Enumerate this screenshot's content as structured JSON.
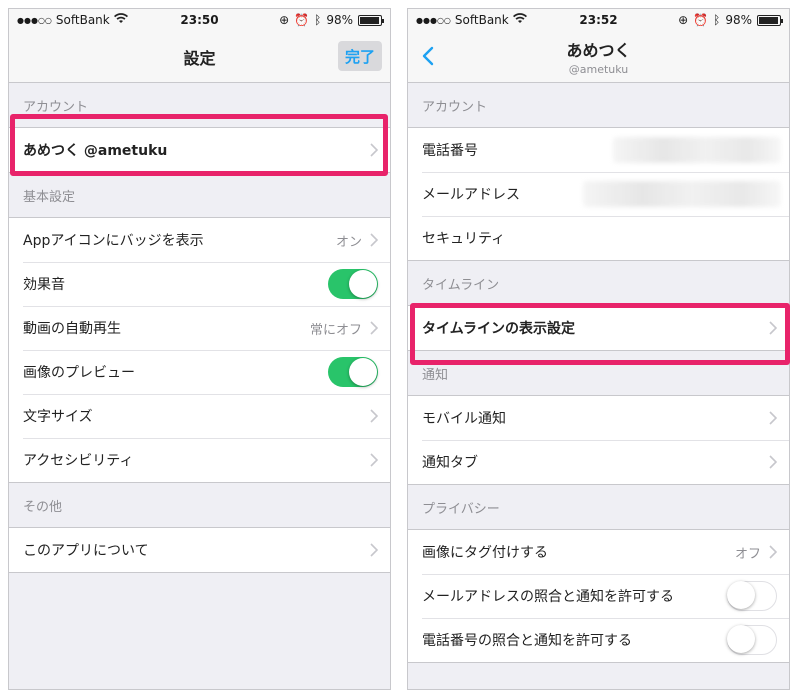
{
  "left": {
    "status": {
      "carrier": "SoftBank",
      "time": "23:50",
      "battery": "98%"
    },
    "nav": {
      "title": "設定",
      "done_label": "完了"
    },
    "sections": [
      {
        "header": "アカウント",
        "rows": [
          {
            "label": "あめつく @ametuku"
          }
        ]
      },
      {
        "header": "基本設定",
        "rows": [
          {
            "label": "Appアイコンにバッジを表示",
            "value": "オン"
          },
          {
            "label": "効果音",
            "toggle": "on"
          },
          {
            "label": "動画の自動再生",
            "value": "常にオフ"
          },
          {
            "label": "画像のプレビュー",
            "toggle": "on"
          },
          {
            "label": "文字サイズ"
          },
          {
            "label": "アクセシビリティ"
          }
        ]
      },
      {
        "header": "その他",
        "rows": [
          {
            "label": "このアプリについて"
          }
        ]
      }
    ]
  },
  "right": {
    "status": {
      "carrier": "SoftBank",
      "time": "23:52",
      "battery": "98%"
    },
    "nav": {
      "title": "あめつく",
      "subtitle": "@ametuku"
    },
    "sections": [
      {
        "header": "アカウント",
        "rows": [
          {
            "label": "電話番号"
          },
          {
            "label": "メールアドレス"
          },
          {
            "label": "セキュリティ"
          }
        ]
      },
      {
        "header": "タイムライン",
        "rows": [
          {
            "label": "タイムラインの表示設定"
          }
        ]
      },
      {
        "header": "通知",
        "rows": [
          {
            "label": "モバイル通知"
          },
          {
            "label": "通知タブ"
          }
        ]
      },
      {
        "header": "プライバシー",
        "rows": [
          {
            "label": "画像にタグ付けする",
            "value": "オフ"
          },
          {
            "label": "メールアドレスの照合と通知を許可する",
            "toggle": "off"
          },
          {
            "label": "電話番号の照合と通知を許可する",
            "toggle": "off"
          }
        ]
      }
    ]
  },
  "colors": {
    "accent": "#1da1f2",
    "toggle_on": "#29c46a",
    "highlight": "#e8236a",
    "background": "#efeff4"
  },
  "icons": [
    "wifi-icon",
    "lock-rotation-icon",
    "alarm-icon",
    "bluetooth-icon",
    "battery-icon",
    "chevron-right-icon",
    "back-chevron-icon"
  ]
}
